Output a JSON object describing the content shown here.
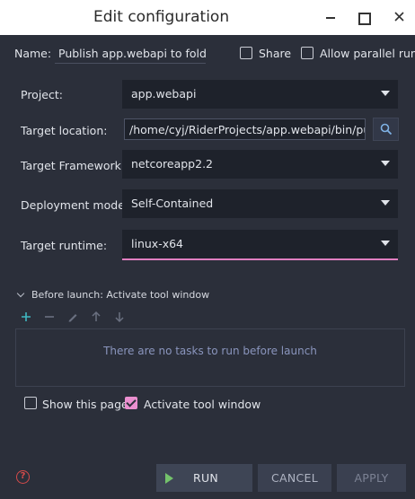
{
  "window": {
    "title": "Edit configuration"
  },
  "name_row": {
    "label": "Name:",
    "value": "Publish app.webapi to folder",
    "share_label": "Share",
    "share_checked": false,
    "parallel_label": "Allow parallel run",
    "parallel_checked": false
  },
  "form": {
    "project": {
      "label": "Project:",
      "value": "app.webapi"
    },
    "target_location": {
      "label": "Target location:",
      "value": "/home/cyj/RiderProjects/app.webapi/bin/publish"
    },
    "target_framework": {
      "label": "Target Framework:",
      "value": "netcoreapp2.2"
    },
    "deployment_mode": {
      "label": "Deployment mode:",
      "value": "Self-Contained"
    },
    "target_runtime": {
      "label": "Target runtime:",
      "value": "linux-x64"
    }
  },
  "before_launch": {
    "title": "Before launch: Activate tool window",
    "empty_text": "There are no tasks to run before launch",
    "tools": [
      "add-icon",
      "remove-icon",
      "edit-icon",
      "move-up-icon",
      "move-down-icon"
    ]
  },
  "options": {
    "show_page_label": "Show this page",
    "show_page_checked": false,
    "activate_label": "Activate tool window",
    "activate_checked": true
  },
  "footer": {
    "run_label": "RUN",
    "cancel_label": "CANCEL",
    "apply_label": "APPLY",
    "help_glyph": "?"
  },
  "colors": {
    "background": "#2b2f3a",
    "accent_pink": "#ea8fcf",
    "run_green": "#74c26b",
    "help_red": "#d64b4b",
    "add_teal": "#3fb8c2"
  }
}
